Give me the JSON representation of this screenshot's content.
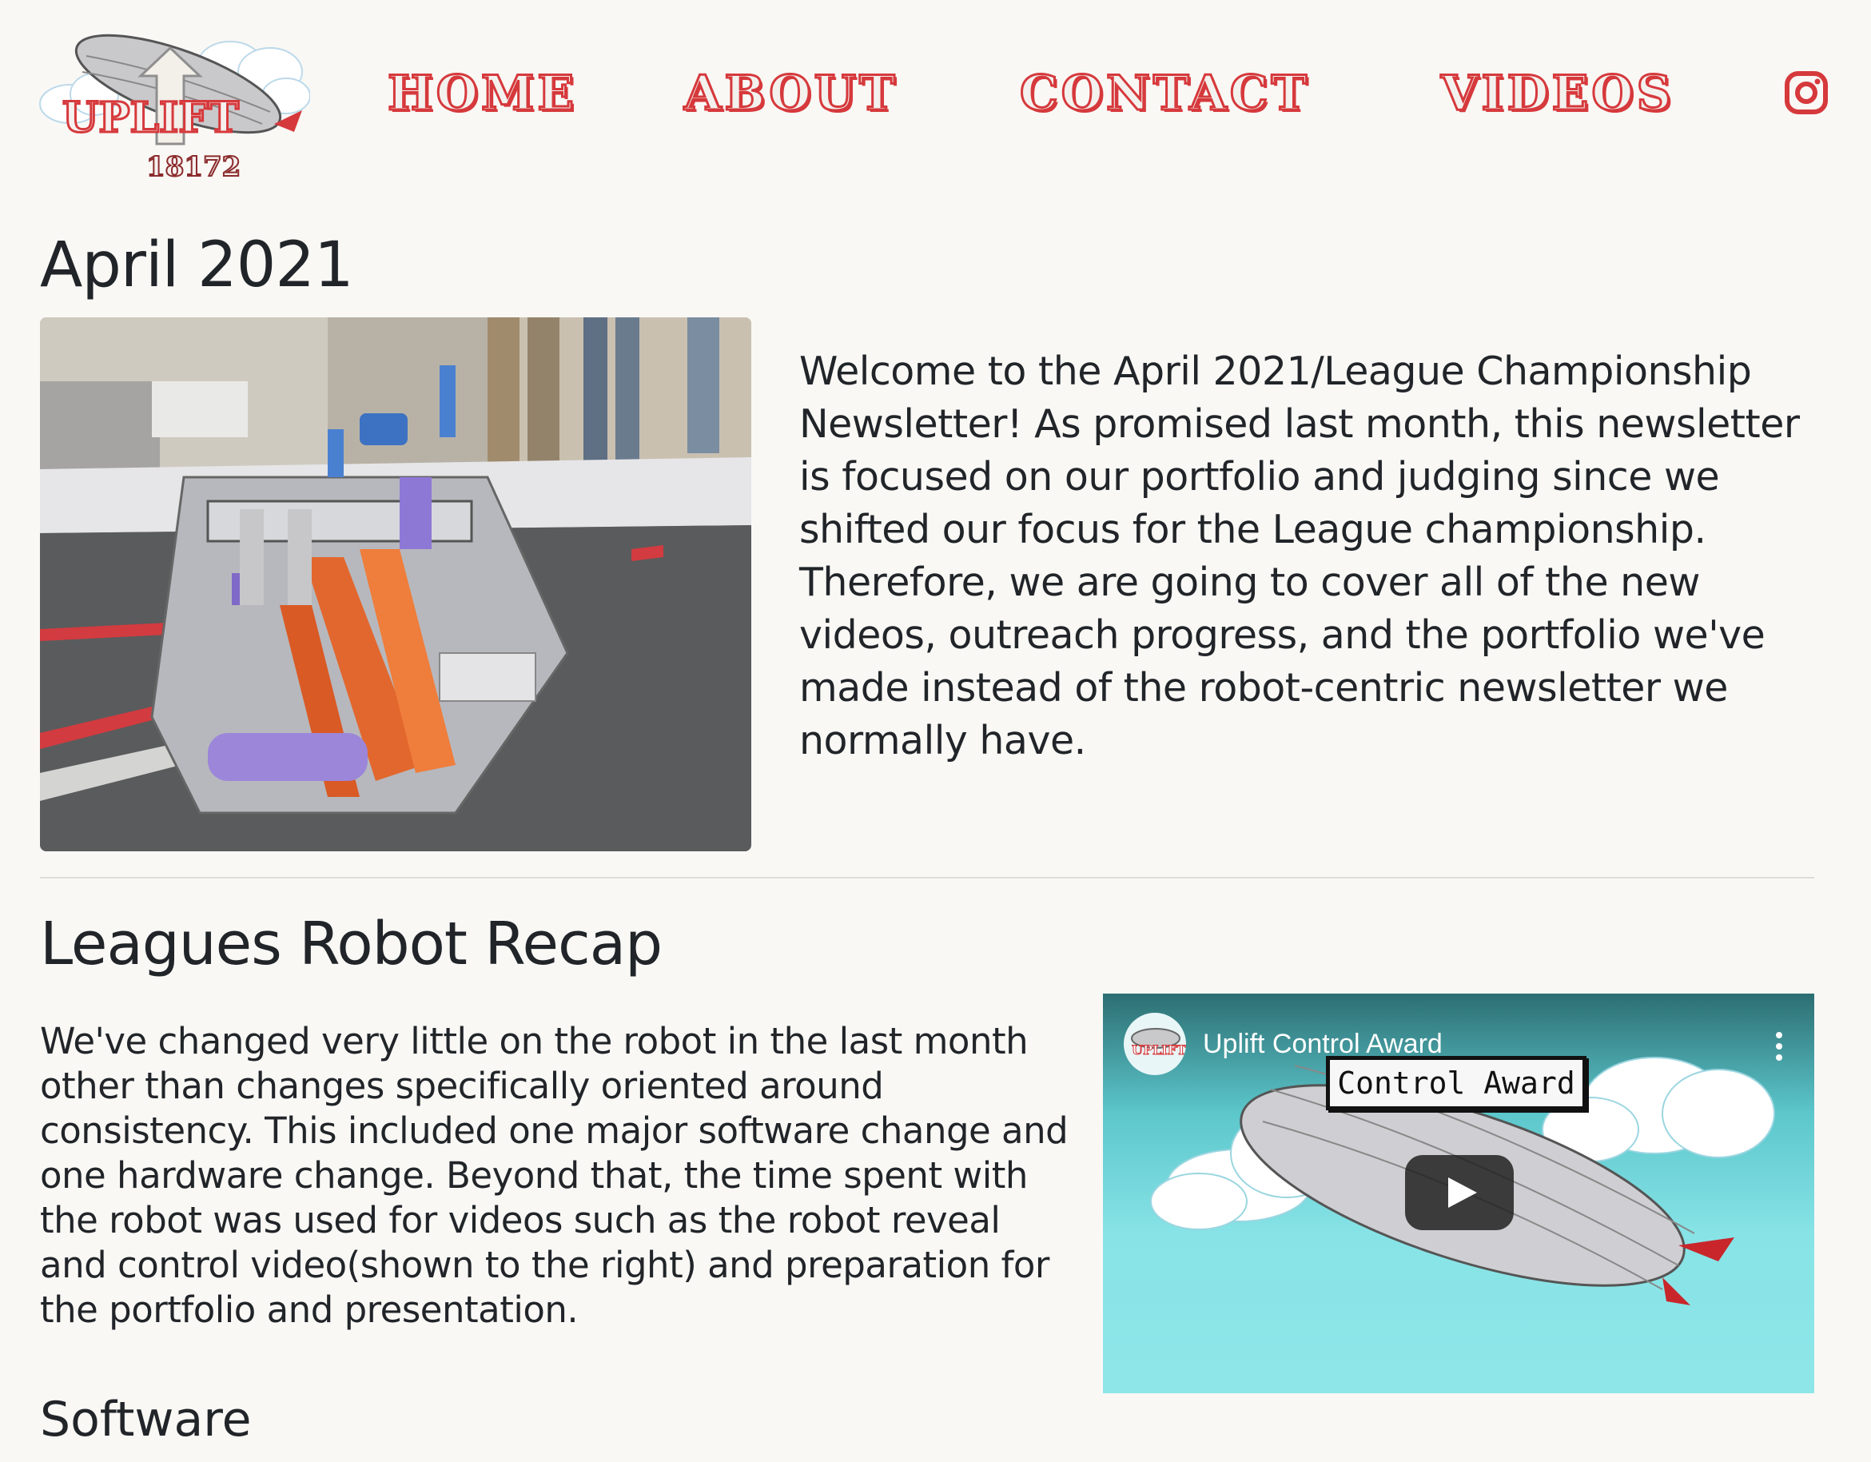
{
  "nav": {
    "logo_text": "UPLIFT",
    "logo_number": "18172",
    "links": [
      "HOME",
      "ABOUT",
      "CONTACT",
      "VIDEOS"
    ],
    "instagram_icon": "instagram-icon",
    "accent_color": "#d6393c"
  },
  "section1": {
    "title": "April 2021",
    "intro": "Welcome to the April 2021/League Championship Newsletter! As promised last month, this newsletter is focused on our portfolio and judging since we shifted our focus for the League championship. Therefore, we are going to cover all of the new videos, outreach progress, and the portfolio we've made instead of the robot-centric newsletter we normally have."
  },
  "section2": {
    "title": "Leagues Robot Recap",
    "body": "We've changed very little on the robot in the last month other than changes specifically oriented around consistency. This included one major software change and one hardware change. Beyond that, the time spent with the robot was used for videos such as the robot reveal and control video(shown to the right) and preparation for the portfolio and presentation.",
    "video": {
      "title": "Uplift Control Award",
      "label": "Control Award"
    }
  },
  "section3": {
    "title": "Software"
  }
}
